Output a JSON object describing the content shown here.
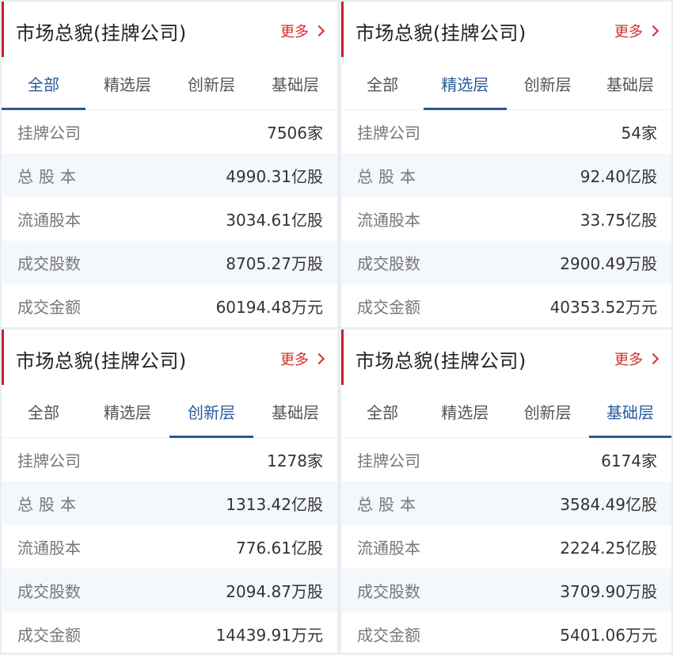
{
  "colors": {
    "accent_red": "#c8202d",
    "active_tab": "#2a5a9c",
    "row_alt": "#f4f7fb"
  },
  "panels": [
    {
      "title": "市场总貌(挂牌公司)",
      "more": "更多",
      "tabs": [
        "全部",
        "精选层",
        "创新层",
        "基础层"
      ],
      "active_tab": "全部",
      "rows": [
        {
          "label": "挂牌公司",
          "value": "7506家"
        },
        {
          "label": "总股本",
          "value": "4990.31亿股"
        },
        {
          "label": "流通股本",
          "value": "3034.61亿股"
        },
        {
          "label": "成交股数",
          "value": "8705.27万股"
        },
        {
          "label": "成交金额",
          "value": "60194.48万元"
        }
      ]
    },
    {
      "title": "市场总貌(挂牌公司)",
      "more": "更多",
      "tabs": [
        "全部",
        "精选层",
        "创新层",
        "基础层"
      ],
      "active_tab": "精选层",
      "rows": [
        {
          "label": "挂牌公司",
          "value": "54家"
        },
        {
          "label": "总股本",
          "value": "92.40亿股"
        },
        {
          "label": "流通股本",
          "value": "33.75亿股"
        },
        {
          "label": "成交股数",
          "value": "2900.49万股"
        },
        {
          "label": "成交金额",
          "value": "40353.52万元"
        }
      ]
    },
    {
      "title": "市场总貌(挂牌公司)",
      "more": "更多",
      "tabs": [
        "全部",
        "精选层",
        "创新层",
        "基础层"
      ],
      "active_tab": "创新层",
      "rows": [
        {
          "label": "挂牌公司",
          "value": "1278家"
        },
        {
          "label": "总股本",
          "value": "1313.42亿股"
        },
        {
          "label": "流通股本",
          "value": "776.61亿股"
        },
        {
          "label": "成交股数",
          "value": "2094.87万股"
        },
        {
          "label": "成交金额",
          "value": "14439.91万元"
        }
      ]
    },
    {
      "title": "市场总貌(挂牌公司)",
      "more": "更多",
      "tabs": [
        "全部",
        "精选层",
        "创新层",
        "基础层"
      ],
      "active_tab": "基础层",
      "rows": [
        {
          "label": "挂牌公司",
          "value": "6174家"
        },
        {
          "label": "总股本",
          "value": "3584.49亿股"
        },
        {
          "label": "流通股本",
          "value": "2224.25亿股"
        },
        {
          "label": "成交股数",
          "value": "3709.90万股"
        },
        {
          "label": "成交金额",
          "value": "5401.06万元"
        }
      ]
    }
  ]
}
